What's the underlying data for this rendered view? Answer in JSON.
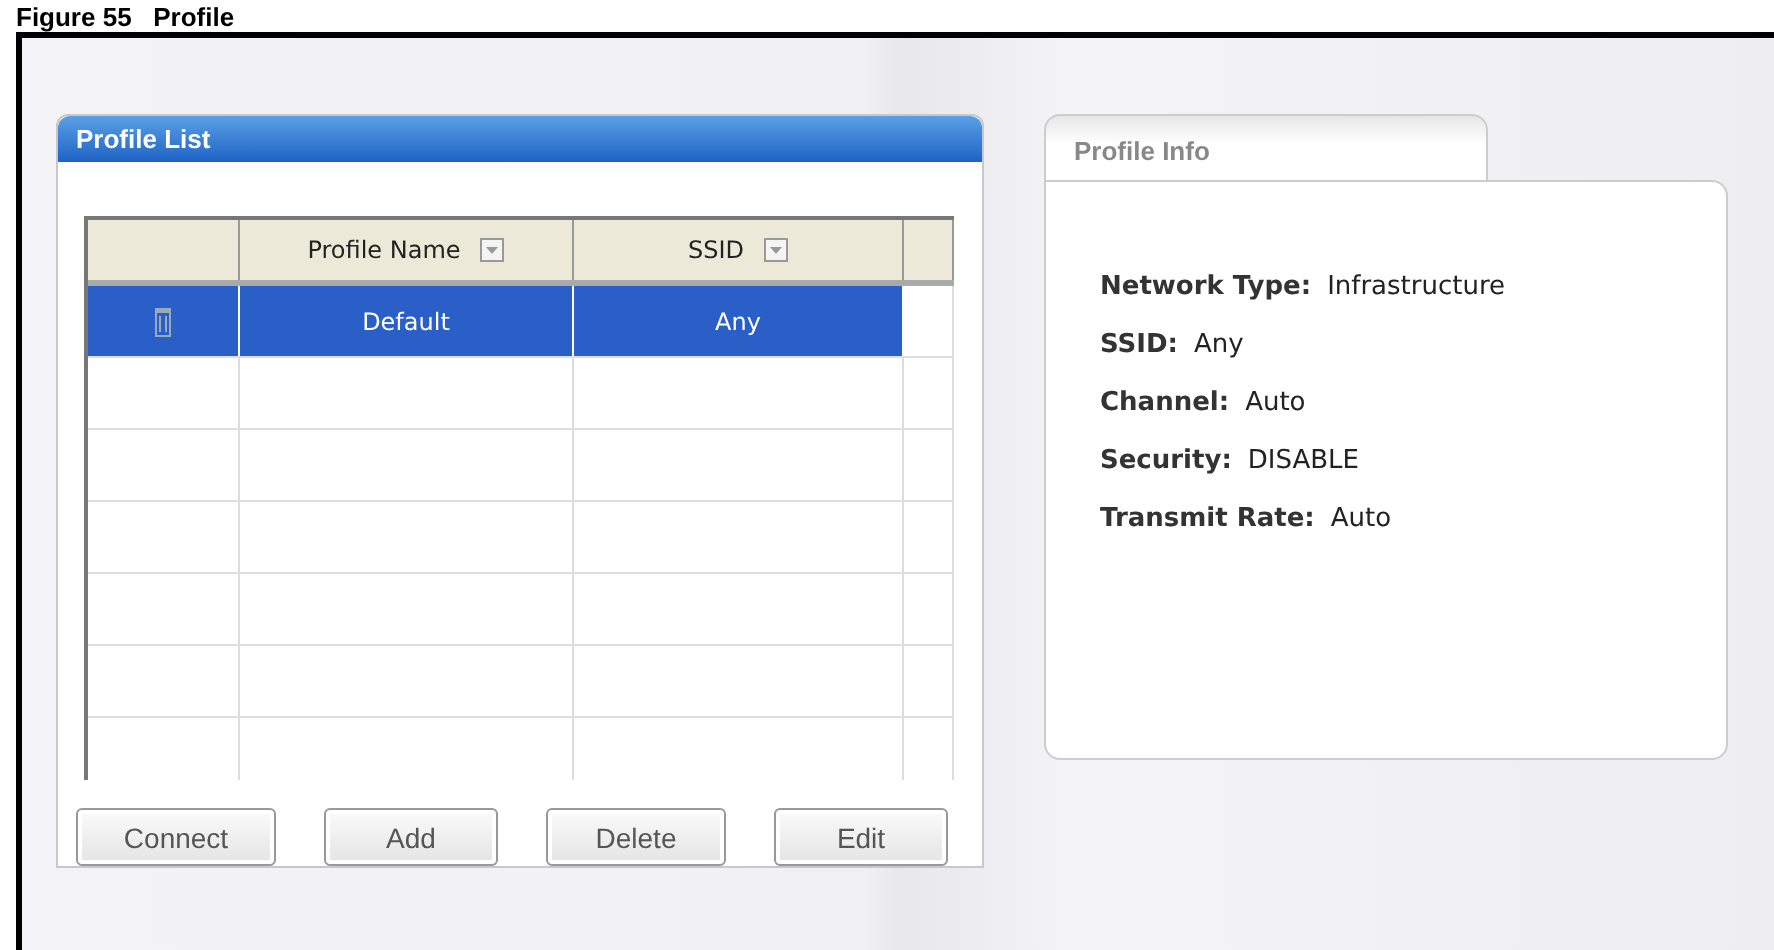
{
  "caption": "Figure 55   Profile",
  "profile_list": {
    "title": "Profile List",
    "columns": [
      {
        "label": "Profile Name"
      },
      {
        "label": "SSID"
      }
    ],
    "rows": [
      {
        "profile_name": "Default",
        "ssid": "Any",
        "selected": true
      }
    ],
    "buttons": [
      "Connect",
      "Add",
      "Delete",
      "Edit"
    ]
  },
  "profile_info": {
    "title": "Profile Info",
    "fields": [
      {
        "label": "Network Type:",
        "value": "Infrastructure"
      },
      {
        "label": "SSID:",
        "value": "Any"
      },
      {
        "label": "Channel:",
        "value": "Auto"
      },
      {
        "label": "Security:",
        "value": "DISABLE"
      },
      {
        "label": "Transmit Rate:",
        "value": "Auto"
      }
    ]
  }
}
